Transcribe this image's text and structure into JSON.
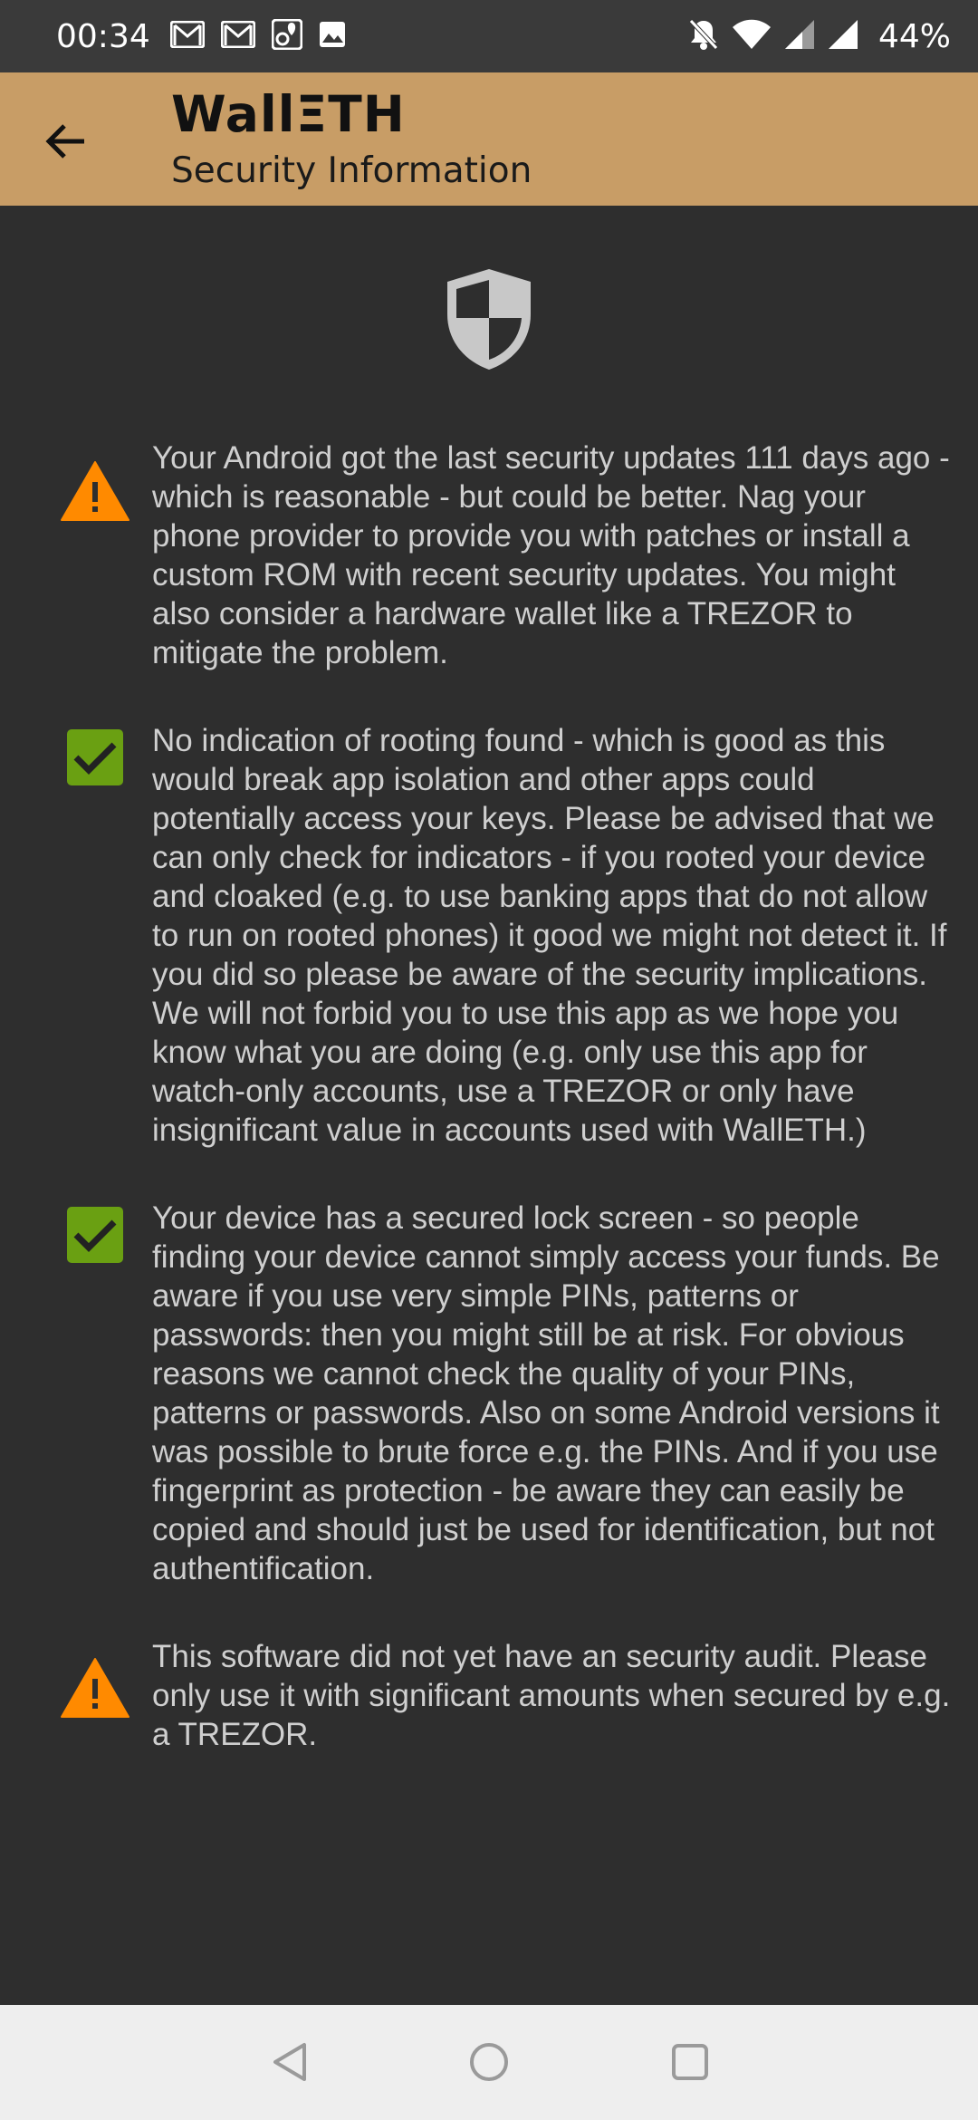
{
  "status_bar": {
    "time": "00:34",
    "battery": "44%",
    "left_icons": [
      "gmail-icon",
      "gmail-icon",
      "maps-icon",
      "photo-icon"
    ],
    "right_icons": [
      "mute-icon",
      "wifi-icon",
      "signal-icon",
      "signal-icon"
    ]
  },
  "app_bar": {
    "title": "WallΞTH",
    "subtitle": "Security Information"
  },
  "colors": {
    "app_bar": "#c89d66",
    "background": "#2e2e2e",
    "text": "#cfcfcf",
    "warning": "#ff8a00",
    "ok": "#6aa012"
  },
  "items": [
    {
      "status": "warning",
      "icon": "warning-icon",
      "text": "Your Android got the last security updates 111 days ago - which is reasonable - but could be better. Nag your phone provider to provide you with patches or install a custom ROM with recent security updates. You might also consider a hardware wallet like a TREZOR to mitigate the problem."
    },
    {
      "status": "ok",
      "icon": "checkbox-checked-icon",
      "text": "No indication of rooting found - which is good as this would break app isolation and other apps could potentially access your keys. Please be advised that we can only check for indicators - if you rooted your device and cloaked (e.g. to use banking apps that do not allow to run on rooted phones) it good we might not detect it. If you did so please be aware of the security implications. We will not forbid you to use this app as we hope you know what you are doing (e.g. only use this app for watch-only accounts, use a TREZOR or only have insignificant value in accounts used with WallETH.)"
    },
    {
      "status": "ok",
      "icon": "checkbox-checked-icon",
      "text": "Your device has a secured lock screen - so people finding your device cannot simply access your funds. Be aware if you use very simple PINs, patterns or passwords: then you might still be at risk. For obvious reasons we cannot check the quality of your PINs, patterns or passwords. Also on some Android versions it was possible to brute force e.g. the PINs. And if you use fingerprint as protection - be aware they can easily be copied and should just be used for identification, but not authentification."
    },
    {
      "status": "warning",
      "icon": "warning-icon",
      "text": "This software did not yet have an security audit. Please only use it with significant amounts when secured by e.g. a TREZOR."
    }
  ],
  "nav_bar": {
    "buttons": [
      "back-nav-icon",
      "home-nav-icon",
      "recents-nav-icon"
    ]
  }
}
